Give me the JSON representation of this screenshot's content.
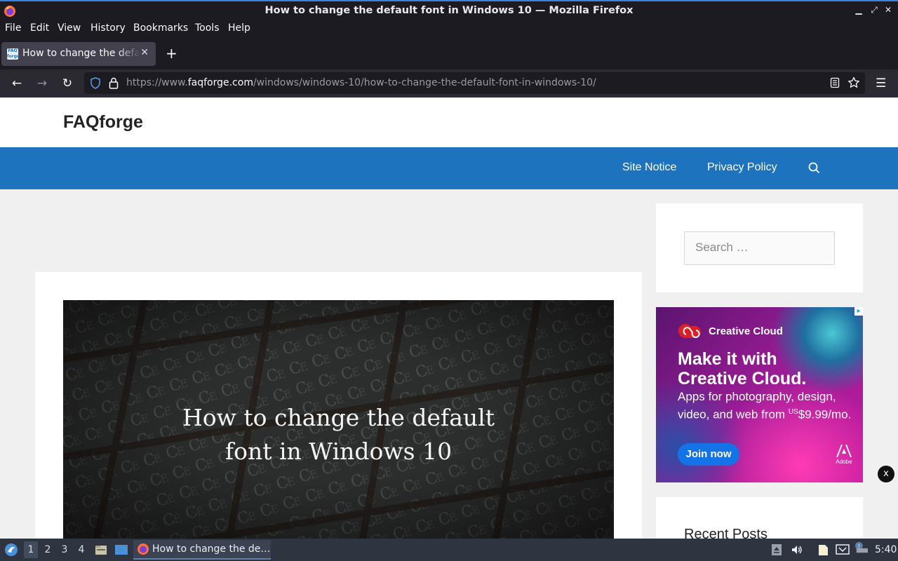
{
  "window": {
    "title": "How to change the default font in Windows 10 — Mozilla Firefox",
    "controls": [
      "minimize",
      "maximize",
      "close"
    ]
  },
  "menubar": {
    "items": [
      {
        "label": "File"
      },
      {
        "label": "Edit"
      },
      {
        "label": "View"
      },
      {
        "label": "History"
      },
      {
        "label": "Bookmarks"
      },
      {
        "label": "Tools"
      },
      {
        "label": "Help"
      }
    ]
  },
  "tabs": [
    {
      "title": "How to change the default font in Windows 10",
      "favicon": "faqforge-favicon",
      "active": true
    }
  ],
  "navbar": {
    "url_prefix": "https://www.",
    "url_domain": "faqforge.com",
    "url_path": "/windows/windows-10/how-to-change-the-default-font-in-windows-10/"
  },
  "site": {
    "title": "FAQforge",
    "nav": [
      {
        "label": "Site Notice"
      },
      {
        "label": "Privacy Policy"
      }
    ],
    "search_placeholder": "Search …",
    "hero_title_line1": "How to change the default",
    "hero_title_line2": "font in Windows 10",
    "recent_posts_heading": "Recent Posts",
    "brand_color": "#1e73be"
  },
  "ad": {
    "brand": "Creative Cloud",
    "headline_line1": "Make it with",
    "headline_line2": "Creative Cloud.",
    "sub_line1": "Apps for photography, design,",
    "sub_line2_pre": "video, and web from ",
    "sub_price_prefix": "US",
    "sub_price": "$9.99/mo.",
    "cta": "Join now",
    "maker": "Adobe",
    "close": "x"
  },
  "taskbar": {
    "workspaces": [
      "1",
      "2",
      "3",
      "4"
    ],
    "active_workspace": "1",
    "task_title": "How to change the de…",
    "clock": "5:40"
  }
}
